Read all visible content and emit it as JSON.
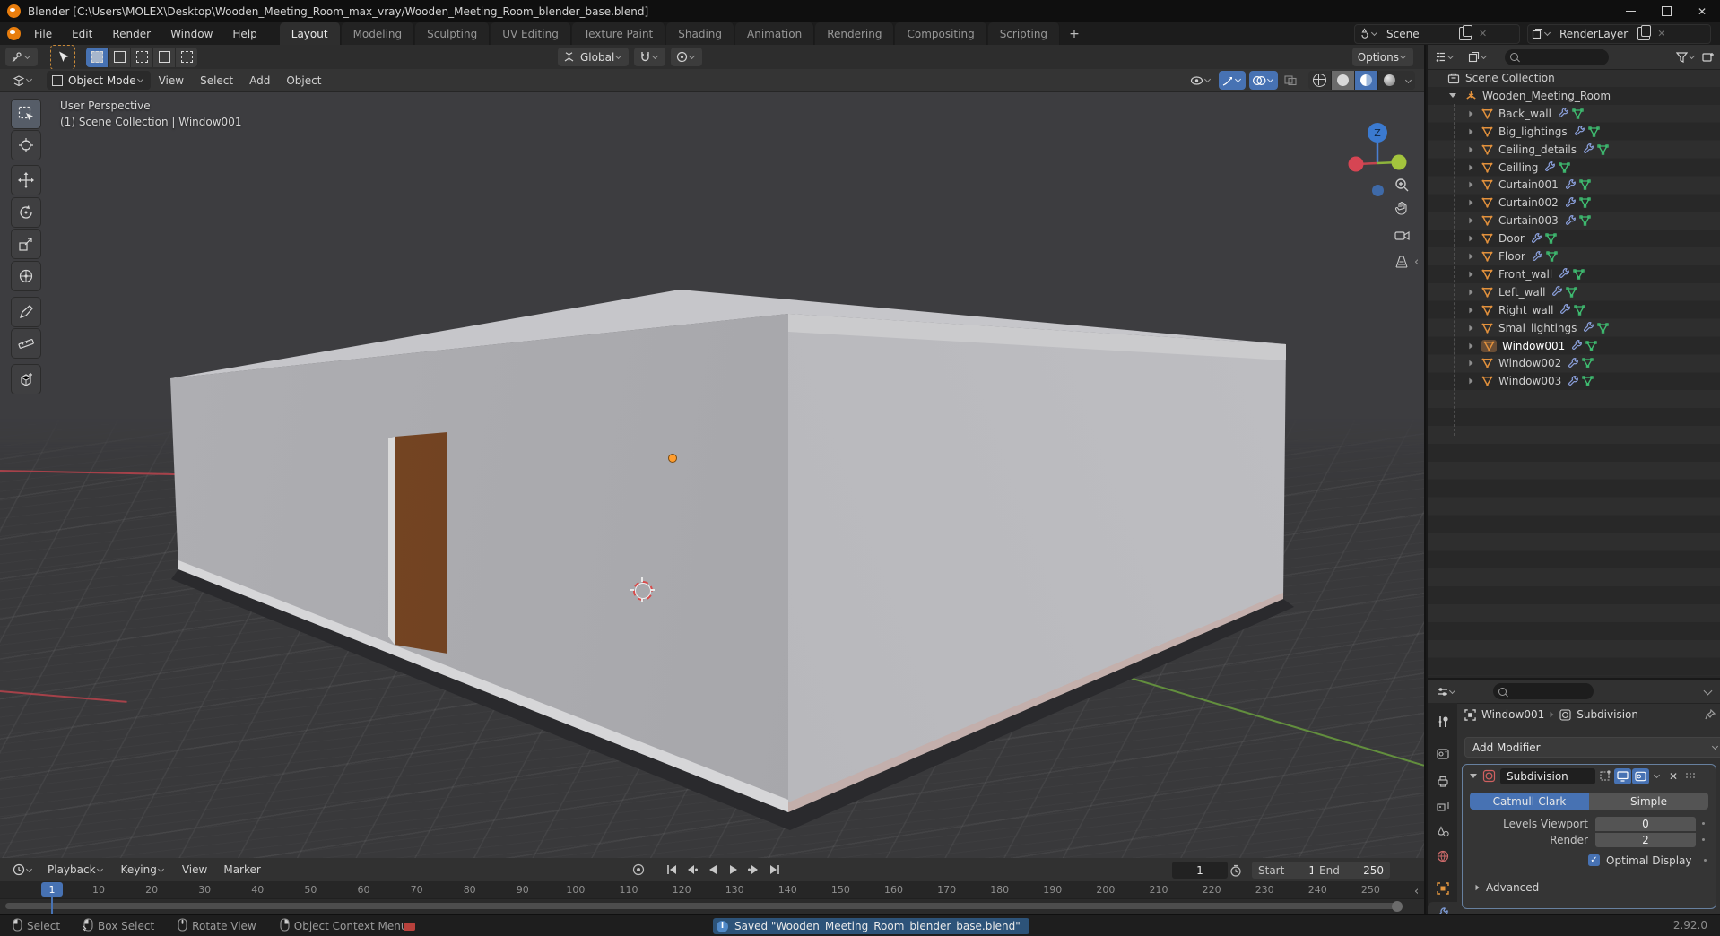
{
  "window": {
    "title": "Blender [C:\\Users\\MOLEX\\Desktop\\Wooden_Meeting_Room_max_vray/Wooden_Meeting_Room_blender_base.blend]"
  },
  "topbar": {
    "app_menus": [
      "File",
      "Edit",
      "Render",
      "Window",
      "Help"
    ],
    "workspace_tabs": [
      "Layout",
      "Modeling",
      "Sculpting",
      "UV Editing",
      "Texture Paint",
      "Shading",
      "Animation",
      "Rendering",
      "Compositing",
      "Scripting"
    ],
    "active_tab": "Layout",
    "new_workspace_button": "+",
    "scene_selector": {
      "value": "Scene"
    },
    "render_layer_selector": {
      "value": "RenderLayer"
    }
  },
  "tool_settings": {
    "orientation": {
      "value": "Global"
    },
    "options_button": "Options"
  },
  "viewport_header": {
    "mode_selector": "Object Mode",
    "menus": [
      "View",
      "Select",
      "Add",
      "Object"
    ]
  },
  "viewport": {
    "overlay_line1": "User Perspective",
    "overlay_line2": "(1) Scene Collection | Window001",
    "nav_gizmo_axis_label": "Z",
    "colors": {
      "axis_x": "#b8434c",
      "axis_y": "#6a9d3e",
      "origin": "#ff9d2e",
      "accent": "#4772b3"
    }
  },
  "outliner": {
    "root_collection": "Scene Collection",
    "collection": {
      "name": "Wooden_Meeting_Room"
    },
    "row_icons": [
      "modifier-wrench-icon",
      "mesh-data-icon",
      "visibility-eye-icon"
    ],
    "objects": [
      {
        "name": "Back_wall"
      },
      {
        "name": "Big_lightings"
      },
      {
        "name": "Ceiling_details"
      },
      {
        "name": "Ceilling"
      },
      {
        "name": "Curtain001"
      },
      {
        "name": "Curtain002"
      },
      {
        "name": "Curtain003"
      },
      {
        "name": "Door"
      },
      {
        "name": "Floor"
      },
      {
        "name": "Front_wall"
      },
      {
        "name": "Left_wall"
      },
      {
        "name": "Right_wall"
      },
      {
        "name": "Smal_lightings"
      },
      {
        "name": "Window001",
        "selected": true
      },
      {
        "name": "Window002"
      },
      {
        "name": "Window003"
      }
    ]
  },
  "properties": {
    "breadcrumb": {
      "object": "Window001",
      "modifier": "Subdivision"
    },
    "add_modifier_button": "Add Modifier",
    "modifier_panel": {
      "name": "Subdivision",
      "type_options": [
        "Catmull-Clark",
        "Simple"
      ],
      "type_active": "Catmull-Clark",
      "fields": [
        {
          "label": "Levels Viewport",
          "value": "0"
        },
        {
          "label": "Render",
          "value": "2"
        }
      ],
      "checkbox": {
        "label": "Optimal Display",
        "checked": true
      },
      "advanced_section": "Advanced"
    }
  },
  "timeline": {
    "menus": [
      {
        "label": "Playback",
        "chevron": true
      },
      {
        "label": "Keying",
        "chevron": true
      },
      {
        "label": "View",
        "chevron": false
      },
      {
        "label": "Marker",
        "chevron": false
      }
    ],
    "current_frame": "1",
    "frame_field_value": "1",
    "start": {
      "label": "Start",
      "value": "1"
    },
    "end": {
      "label": "End",
      "value": "250"
    },
    "ruler_ticks": [
      10,
      20,
      30,
      40,
      50,
      60,
      70,
      80,
      90,
      100,
      110,
      120,
      130,
      140,
      150,
      160,
      170,
      180,
      190,
      200,
      210,
      220,
      230,
      240,
      250
    ]
  },
  "statusbar": {
    "hints": [
      {
        "icon": "mouse-left-icon",
        "label": "Select"
      },
      {
        "icon": "mouse-left-drag-icon",
        "label": "Box Select"
      },
      {
        "icon": "mouse-middle-icon",
        "label": "Rotate View"
      },
      {
        "icon": "mouse-right-icon",
        "label": "Object Context Menu"
      }
    ],
    "message": "Saved \"Wooden_Meeting_Room_blender_base.blend\"",
    "version": "2.92.0"
  }
}
